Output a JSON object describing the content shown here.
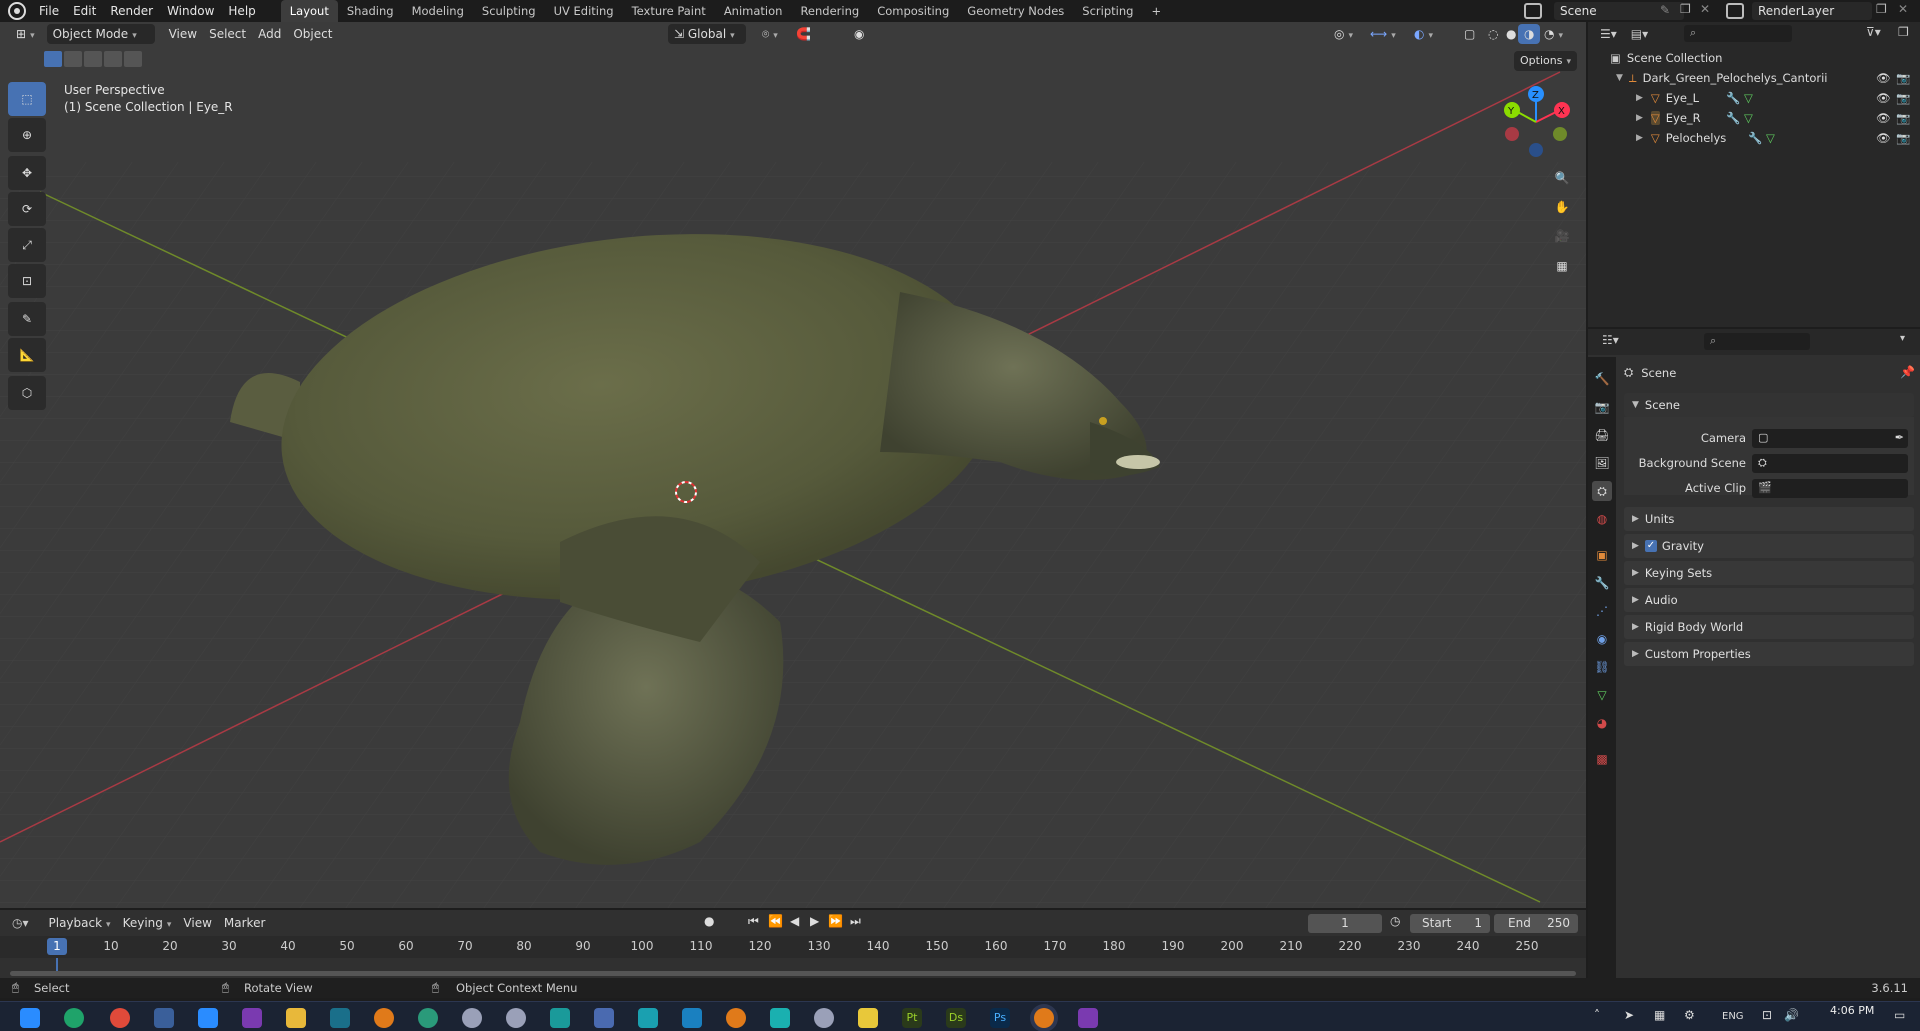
{
  "topbar": {
    "menus": [
      "File",
      "Edit",
      "Render",
      "Window",
      "Help"
    ],
    "workspaces": [
      "Layout",
      "Shading",
      "Modeling",
      "Sculpting",
      "UV Editing",
      "Texture Paint",
      "Animation",
      "Rendering",
      "Compositing",
      "Geometry Nodes",
      "Scripting"
    ],
    "active_workspace": "Layout",
    "add_tab": "+",
    "scene_name": "Scene",
    "view_layer": "RenderLayer"
  },
  "viewport_header": {
    "mode": "Object Mode",
    "menus": [
      "View",
      "Select",
      "Add",
      "Object"
    ],
    "orientation": "Global",
    "options": "Options"
  },
  "viewport": {
    "perspective": "User Perspective",
    "collection_info": "(1) Scene Collection | Eye_R",
    "gizmo_axes": [
      "Z",
      "Y",
      "X"
    ]
  },
  "outliner": {
    "root": "Scene Collection",
    "items": [
      {
        "name": "Dark_Green_Pelochelys_Cantorii",
        "level": 1
      },
      {
        "name": "Eye_L",
        "level": 2
      },
      {
        "name": "Eye_R",
        "level": 2
      },
      {
        "name": "Pelochelys",
        "level": 2
      }
    ]
  },
  "properties": {
    "context": "Scene",
    "panel_title": "Scene",
    "fields": [
      {
        "label": "Camera"
      },
      {
        "label": "Background Scene"
      },
      {
        "label": "Active Clip"
      }
    ],
    "subpanels": [
      "Units",
      "Gravity",
      "Keying Sets",
      "Audio",
      "Rigid Body World",
      "Custom Properties"
    ],
    "gravity_checked": true
  },
  "timeline": {
    "menus": [
      "Playback",
      "Keying",
      "View",
      "Marker"
    ],
    "current_frame": "1",
    "start_label": "Start",
    "start_value": "1",
    "end_label": "End",
    "end_value": "250",
    "ticks": [
      "1",
      "10",
      "20",
      "30",
      "40",
      "50",
      "60",
      "70",
      "80",
      "90",
      "100",
      "110",
      "120",
      "130",
      "140",
      "150",
      "160",
      "170",
      "180",
      "190",
      "200",
      "210",
      "220",
      "230",
      "240",
      "250"
    ]
  },
  "statusbar": {
    "select": "Select",
    "rotate": "Rotate View",
    "context_menu": "Object Context Menu",
    "version": "3.6.11"
  },
  "taskbar": {
    "icons": [
      "windows",
      "edge",
      "chrome",
      "calculator",
      "vscode",
      "onenote",
      "explorer",
      "blender",
      "pycharm",
      "teams",
      "3dsmax",
      "3dsmax-alt",
      "blender",
      "blender-alt",
      "maya",
      "obs",
      "python",
      "pt",
      "ds",
      "ps",
      "blender",
      "visual-studio"
    ],
    "lang": "ENG",
    "time": "4:06 PM"
  },
  "colors": {
    "accent": "#4772b3",
    "x_axis": "#ff3352",
    "y_axis": "#8bdc00",
    "z_axis": "#2890ff"
  }
}
